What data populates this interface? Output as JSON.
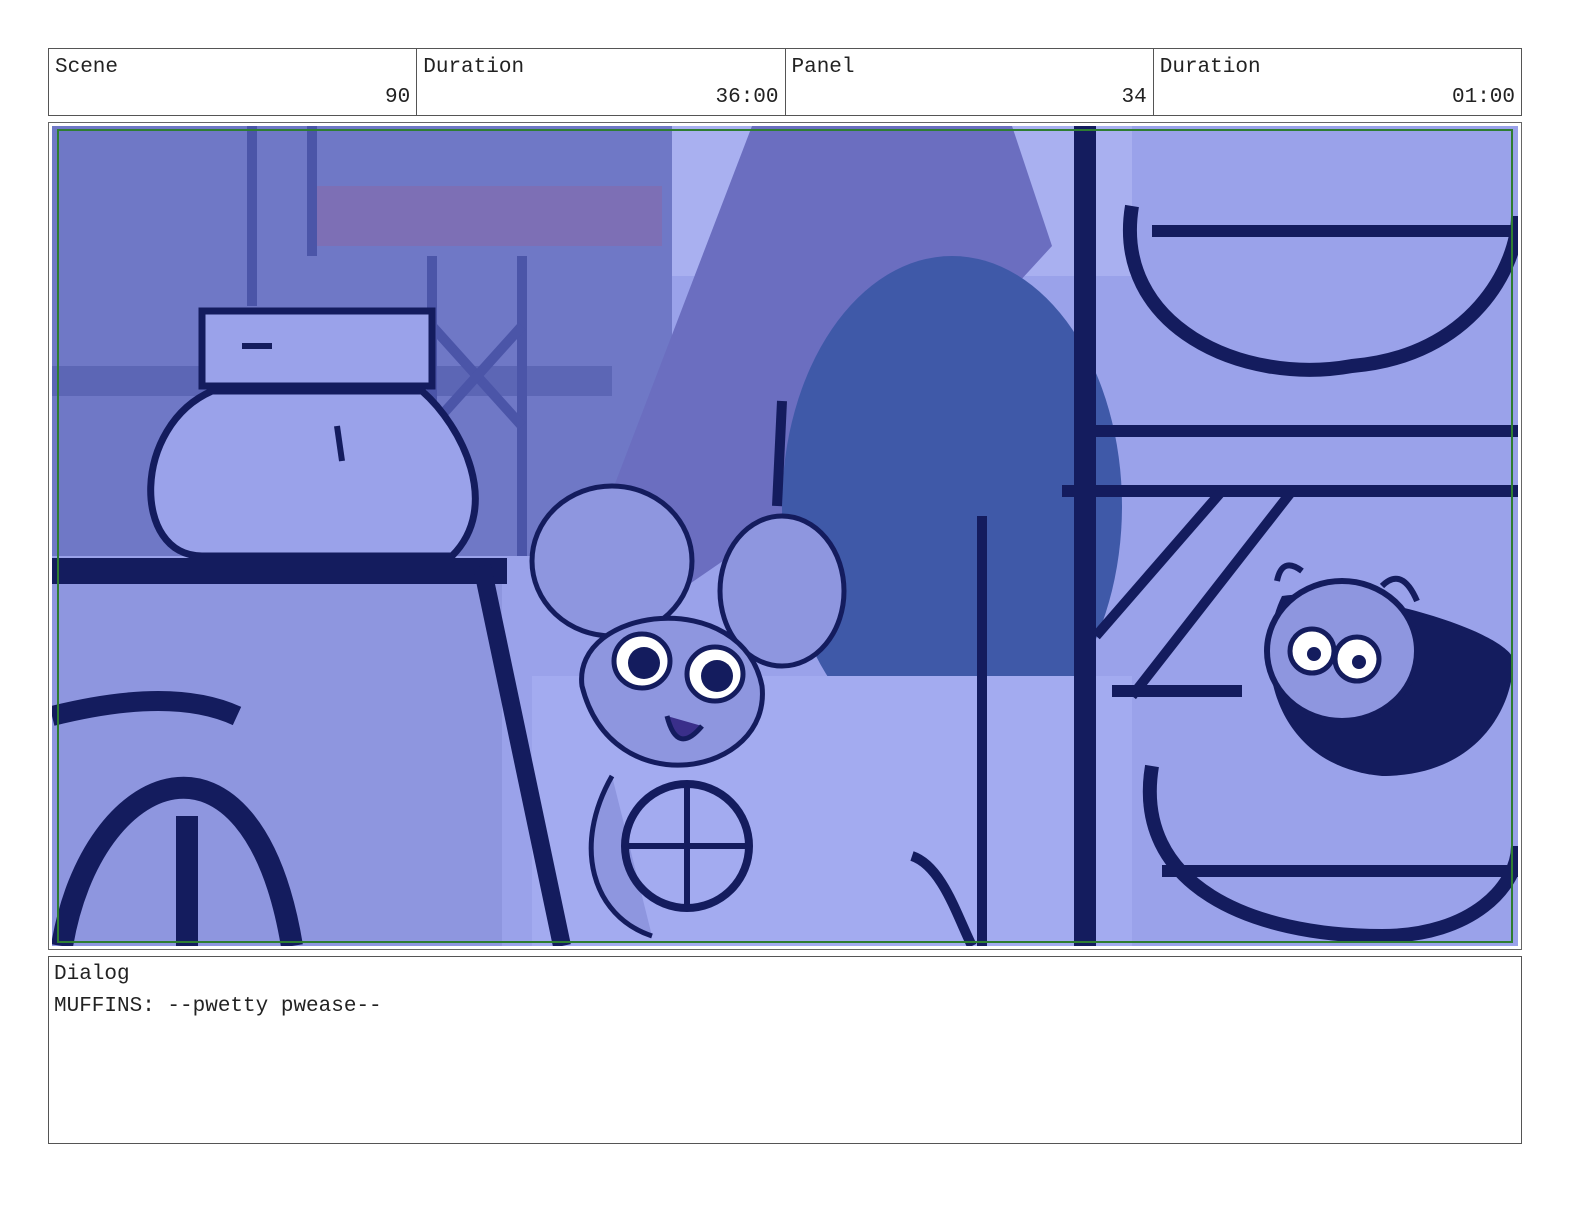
{
  "header": {
    "scene_label": "Scene",
    "scene_value": "90",
    "scene_duration_label": "Duration",
    "scene_duration_value": "36:00",
    "panel_label": "Panel",
    "panel_value": "34",
    "panel_duration_label": "Duration",
    "panel_duration_value": "01:00"
  },
  "frame": {
    "tint_color": "#8f96e0",
    "ink_color": "#141c5e",
    "safe_area_color": "#2e7d32"
  },
  "dialog": {
    "label": "Dialog",
    "text": "MUFFINS: --pwetty pwease--"
  }
}
